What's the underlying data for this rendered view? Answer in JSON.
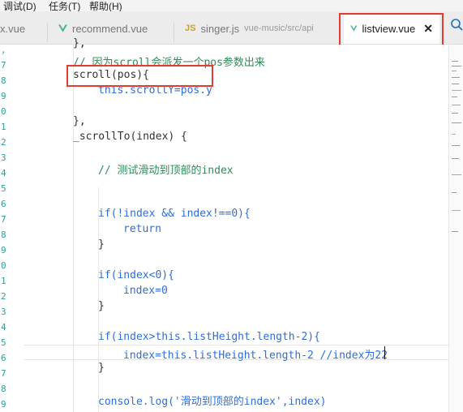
{
  "menu": {
    "items": [
      "调试(D)",
      "任务(T)",
      "帮助(H)"
    ]
  },
  "tabs": [
    {
      "name": "recommend.vue",
      "icon": "vue-icon",
      "active": false
    },
    {
      "name": "singer.js",
      "icon": "js-icon",
      "path": "vue-music/src/api",
      "active": false
    },
    {
      "name": "listview.vue",
      "icon": "vue-icon",
      "active": true
    }
  ],
  "partial_tab": "x.vue",
  "code_lines": [
    "},",
    "// 因为scroll会派发一个pos参数出来",
    "scroll(pos){",
    "this.scrollY=pos.y",
    "",
    "},",
    "_scrollTo(index) {",
    "",
    "// 测试滑动到顶部的index",
    "",
    "",
    "if(!index && index!==0){",
    "return",
    "}",
    "",
    "if(index<0){",
    "index=0",
    "}",
    "",
    "if(index>this.listHeight.length-2){",
    "index=this.listHeight.length-2 //index为22",
    "}",
    "",
    "console.log('滑动到顶部的index',index)"
  ],
  "colors": {
    "vue_green": "#41b883",
    "highlight_red": "#e03c31",
    "keyword_blue": "#2f6ed6",
    "comment_green": "#2e8b57",
    "string_red": "#c0392b"
  }
}
